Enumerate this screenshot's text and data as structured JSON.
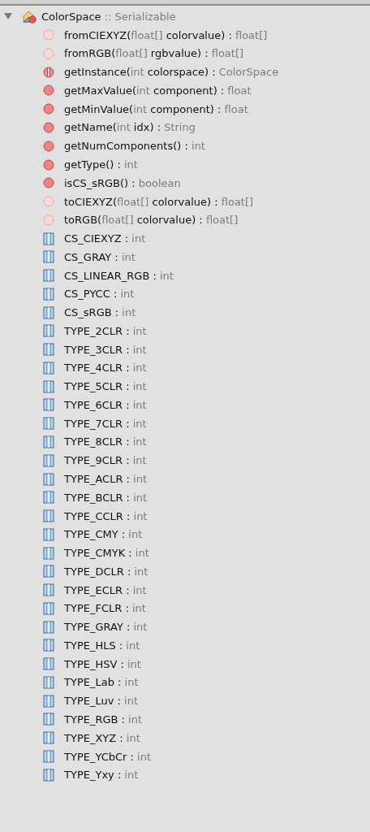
{
  "tree": {
    "expanded": true,
    "label": "ColorSpace",
    "suffix": ":: Serializable",
    "members": [
      {
        "kind": "abstract",
        "parts": [
          {
            "text": "fromCIEXYZ(",
            "muted": false
          },
          {
            "text": "float[]",
            "muted": true
          },
          {
            "text": " colorvalue) : ",
            "muted": false
          },
          {
            "text": "float[]",
            "muted": true
          }
        ]
      },
      {
        "kind": "abstract",
        "parts": [
          {
            "text": "fromRGB(",
            "muted": false
          },
          {
            "text": "float[]",
            "muted": true
          },
          {
            "text": " rgbvalue) : ",
            "muted": false
          },
          {
            "text": "float[]",
            "muted": true
          }
        ]
      },
      {
        "kind": "static",
        "parts": [
          {
            "text": "getInstance(",
            "muted": false
          },
          {
            "text": "int",
            "muted": true
          },
          {
            "text": " colorspace) : ",
            "muted": false
          },
          {
            "text": "ColorSpace",
            "muted": true
          }
        ]
      },
      {
        "kind": "method",
        "parts": [
          {
            "text": "getMaxValue(",
            "muted": false
          },
          {
            "text": "int",
            "muted": true
          },
          {
            "text": " component) : ",
            "muted": false
          },
          {
            "text": "float",
            "muted": true
          }
        ]
      },
      {
        "kind": "method",
        "parts": [
          {
            "text": "getMinValue(",
            "muted": false
          },
          {
            "text": "int",
            "muted": true
          },
          {
            "text": " component) : ",
            "muted": false
          },
          {
            "text": "float",
            "muted": true
          }
        ]
      },
      {
        "kind": "method",
        "parts": [
          {
            "text": "getName(",
            "muted": false
          },
          {
            "text": "int",
            "muted": true
          },
          {
            "text": " idx) : ",
            "muted": false
          },
          {
            "text": "String",
            "muted": true
          }
        ]
      },
      {
        "kind": "method",
        "parts": [
          {
            "text": "getNumComponents() : ",
            "muted": false
          },
          {
            "text": "int",
            "muted": true
          }
        ]
      },
      {
        "kind": "method",
        "parts": [
          {
            "text": "getType() : ",
            "muted": false
          },
          {
            "text": "int",
            "muted": true
          }
        ]
      },
      {
        "kind": "method",
        "parts": [
          {
            "text": "isCS_sRGB() : ",
            "muted": false
          },
          {
            "text": "boolean",
            "muted": true
          }
        ]
      },
      {
        "kind": "abstract",
        "parts": [
          {
            "text": "toCIEXYZ(",
            "muted": false
          },
          {
            "text": "float[]",
            "muted": true
          },
          {
            "text": " colorvalue) : ",
            "muted": false
          },
          {
            "text": "float[]",
            "muted": true
          }
        ]
      },
      {
        "kind": "abstract",
        "parts": [
          {
            "text": "toRGB(",
            "muted": false
          },
          {
            "text": "float[]",
            "muted": true
          },
          {
            "text": " colorvalue) : ",
            "muted": false
          },
          {
            "text": "float[]",
            "muted": true
          }
        ]
      },
      {
        "kind": "field",
        "parts": [
          {
            "text": "CS_CIEXYZ : ",
            "muted": false
          },
          {
            "text": "int",
            "muted": true
          }
        ]
      },
      {
        "kind": "field",
        "parts": [
          {
            "text": "CS_GRAY : ",
            "muted": false
          },
          {
            "text": "int",
            "muted": true
          }
        ]
      },
      {
        "kind": "field",
        "parts": [
          {
            "text": "CS_LINEAR_RGB : ",
            "muted": false
          },
          {
            "text": "int",
            "muted": true
          }
        ]
      },
      {
        "kind": "field",
        "parts": [
          {
            "text": "CS_PYCC : ",
            "muted": false
          },
          {
            "text": "int",
            "muted": true
          }
        ]
      },
      {
        "kind": "field",
        "parts": [
          {
            "text": "CS_sRGB : ",
            "muted": false
          },
          {
            "text": "int",
            "muted": true
          }
        ]
      },
      {
        "kind": "field",
        "parts": [
          {
            "text": "TYPE_2CLR : ",
            "muted": false
          },
          {
            "text": "int",
            "muted": true
          }
        ]
      },
      {
        "kind": "field",
        "parts": [
          {
            "text": "TYPE_3CLR : ",
            "muted": false
          },
          {
            "text": "int",
            "muted": true
          }
        ]
      },
      {
        "kind": "field",
        "parts": [
          {
            "text": "TYPE_4CLR : ",
            "muted": false
          },
          {
            "text": "int",
            "muted": true
          }
        ]
      },
      {
        "kind": "field",
        "parts": [
          {
            "text": "TYPE_5CLR : ",
            "muted": false
          },
          {
            "text": "int",
            "muted": true
          }
        ]
      },
      {
        "kind": "field",
        "parts": [
          {
            "text": "TYPE_6CLR : ",
            "muted": false
          },
          {
            "text": "int",
            "muted": true
          }
        ]
      },
      {
        "kind": "field",
        "parts": [
          {
            "text": "TYPE_7CLR : ",
            "muted": false
          },
          {
            "text": "int",
            "muted": true
          }
        ]
      },
      {
        "kind": "field",
        "parts": [
          {
            "text": "TYPE_8CLR : ",
            "muted": false
          },
          {
            "text": "int",
            "muted": true
          }
        ]
      },
      {
        "kind": "field",
        "parts": [
          {
            "text": "TYPE_9CLR : ",
            "muted": false
          },
          {
            "text": "int",
            "muted": true
          }
        ]
      },
      {
        "kind": "field",
        "parts": [
          {
            "text": "TYPE_ACLR : ",
            "muted": false
          },
          {
            "text": "int",
            "muted": true
          }
        ]
      },
      {
        "kind": "field",
        "parts": [
          {
            "text": "TYPE_BCLR : ",
            "muted": false
          },
          {
            "text": "int",
            "muted": true
          }
        ]
      },
      {
        "kind": "field",
        "parts": [
          {
            "text": "TYPE_CCLR : ",
            "muted": false
          },
          {
            "text": "int",
            "muted": true
          }
        ]
      },
      {
        "kind": "field",
        "parts": [
          {
            "text": "TYPE_CMY : ",
            "muted": false
          },
          {
            "text": "int",
            "muted": true
          }
        ]
      },
      {
        "kind": "field",
        "parts": [
          {
            "text": "TYPE_CMYK : ",
            "muted": false
          },
          {
            "text": "int",
            "muted": true
          }
        ]
      },
      {
        "kind": "field",
        "parts": [
          {
            "text": "TYPE_DCLR : ",
            "muted": false
          },
          {
            "text": "int",
            "muted": true
          }
        ]
      },
      {
        "kind": "field",
        "parts": [
          {
            "text": "TYPE_ECLR : ",
            "muted": false
          },
          {
            "text": "int",
            "muted": true
          }
        ]
      },
      {
        "kind": "field",
        "parts": [
          {
            "text": "TYPE_FCLR : ",
            "muted": false
          },
          {
            "text": "int",
            "muted": true
          }
        ]
      },
      {
        "kind": "field",
        "parts": [
          {
            "text": "TYPE_GRAY : ",
            "muted": false
          },
          {
            "text": "int",
            "muted": true
          }
        ]
      },
      {
        "kind": "field",
        "parts": [
          {
            "text": "TYPE_HLS : ",
            "muted": false
          },
          {
            "text": "int",
            "muted": true
          }
        ]
      },
      {
        "kind": "field",
        "parts": [
          {
            "text": "TYPE_HSV : ",
            "muted": false
          },
          {
            "text": "int",
            "muted": true
          }
        ]
      },
      {
        "kind": "field",
        "parts": [
          {
            "text": "TYPE_Lab : ",
            "muted": false
          },
          {
            "text": "int",
            "muted": true
          }
        ]
      },
      {
        "kind": "field",
        "parts": [
          {
            "text": "TYPE_Luv : ",
            "muted": false
          },
          {
            "text": "int",
            "muted": true
          }
        ]
      },
      {
        "kind": "field",
        "parts": [
          {
            "text": "TYPE_RGB : ",
            "muted": false
          },
          {
            "text": "int",
            "muted": true
          }
        ]
      },
      {
        "kind": "field",
        "parts": [
          {
            "text": "TYPE_XYZ : ",
            "muted": false
          },
          {
            "text": "int",
            "muted": true
          }
        ]
      },
      {
        "kind": "field",
        "parts": [
          {
            "text": "TYPE_YCbCr : ",
            "muted": false
          },
          {
            "text": "int",
            "muted": true
          }
        ]
      },
      {
        "kind": "field",
        "parts": [
          {
            "text": "TYPE_Yxy : ",
            "muted": false
          },
          {
            "text": "int",
            "muted": true
          }
        ]
      }
    ]
  }
}
